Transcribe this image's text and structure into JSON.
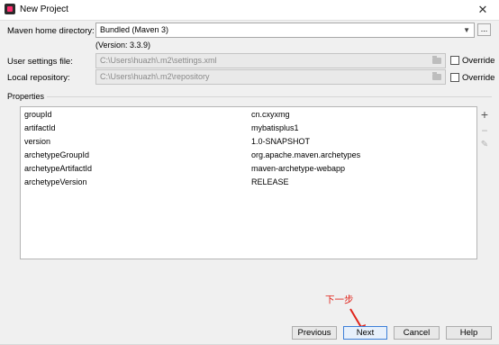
{
  "window": {
    "title": "New Project",
    "close_glyph": "✕"
  },
  "maven_home": {
    "label": "Maven home directory:",
    "value": "Bundled (Maven 3)",
    "version": "(Version: 3.3.9)",
    "browse_label": "..."
  },
  "user_settings": {
    "label": "User settings file:",
    "value": "C:\\Users\\huazh\\.m2\\settings.xml",
    "override_label": "Override"
  },
  "local_repo": {
    "label": "Local repository:",
    "value": "C:\\Users\\huazh\\.m2\\repository",
    "override_label": "Override"
  },
  "properties": {
    "section_label": "Properties",
    "rows": [
      {
        "key": "groupId",
        "value": "cn.cxyxmg"
      },
      {
        "key": "artifactId",
        "value": "mybatisplus1"
      },
      {
        "key": "version",
        "value": "1.0-SNAPSHOT"
      },
      {
        "key": "archetypeGroupId",
        "value": "org.apache.maven.archetypes"
      },
      {
        "key": "archetypeArtifactId",
        "value": "maven-archetype-webapp"
      },
      {
        "key": "archetypeVersion",
        "value": "RELEASE"
      }
    ],
    "tools": {
      "add": "+",
      "remove": "−",
      "edit": "✎"
    }
  },
  "annotation": {
    "text": "下一步",
    "color": "#e0241b"
  },
  "buttons": {
    "previous": "Previous",
    "next": "Next",
    "cancel": "Cancel",
    "help": "Help"
  },
  "colors": {
    "accent": "#3c7fd8"
  }
}
